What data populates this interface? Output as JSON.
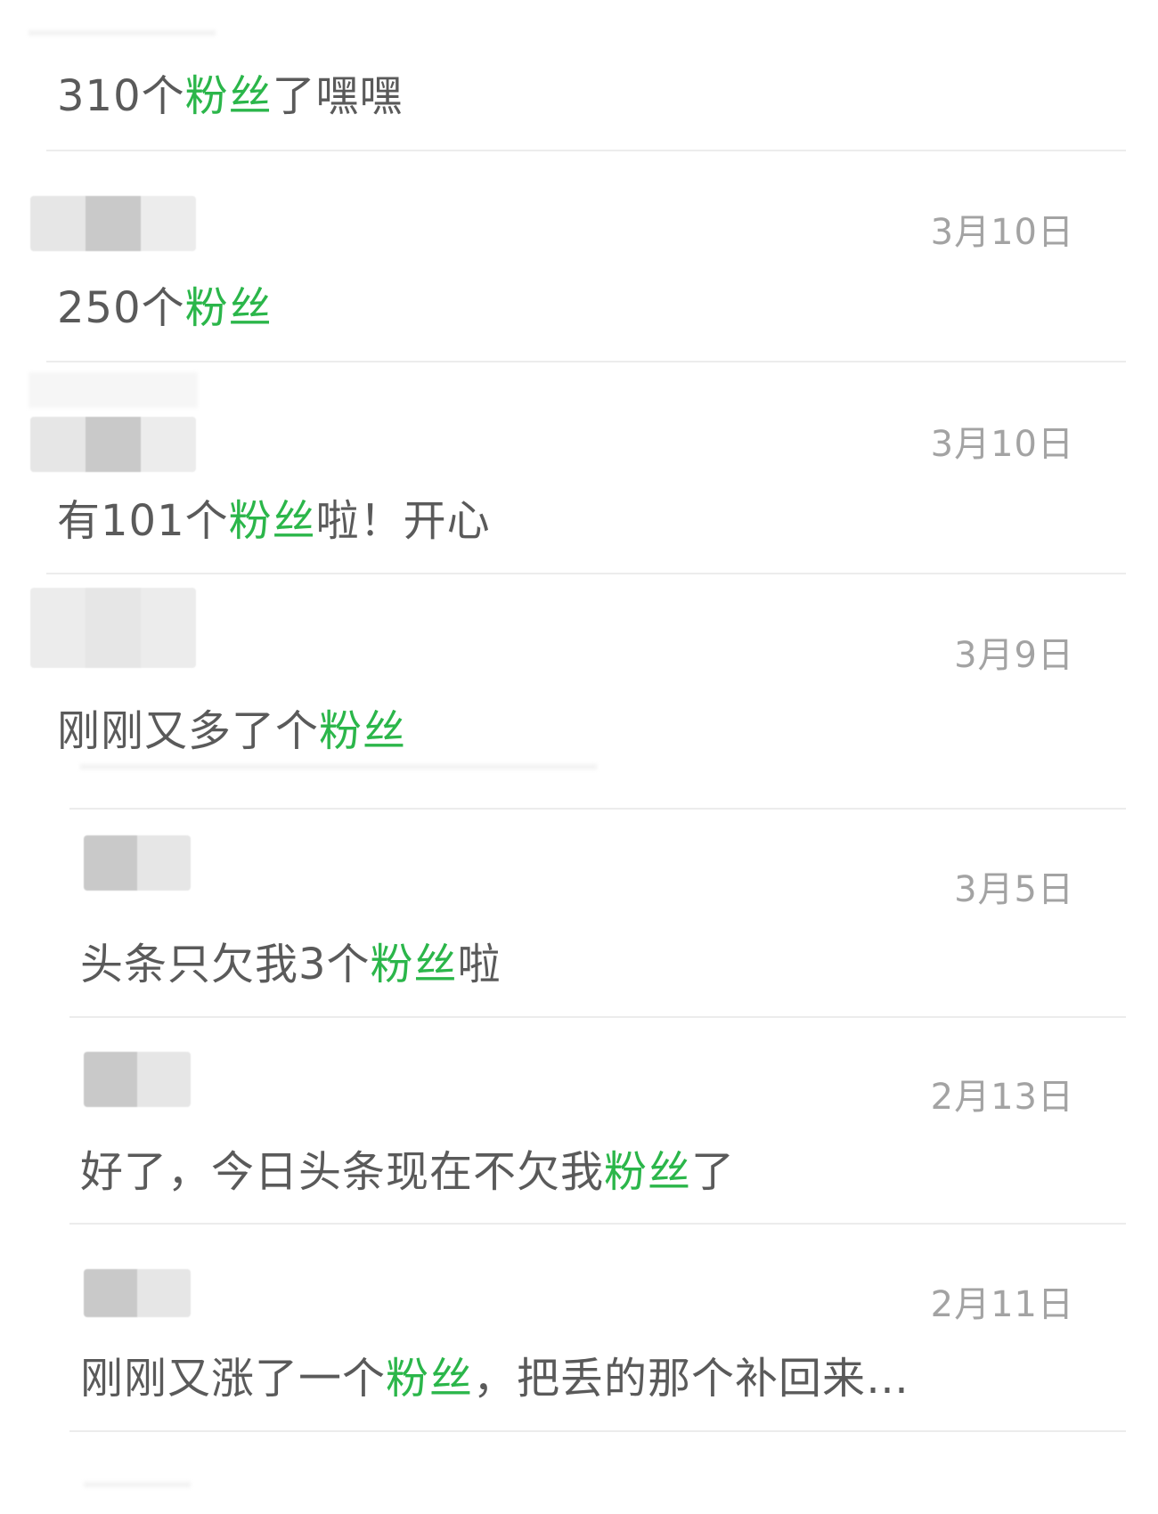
{
  "keyword_color": "#2bb64a",
  "feed": {
    "top_message": {
      "before": "310个",
      "keyword": "粉丝",
      "after": "了嘿嘿"
    },
    "entries": [
      {
        "date": "3月10日",
        "before": "250个",
        "keyword": "粉丝",
        "after": ""
      },
      {
        "date": "3月10日",
        "before": "有101个",
        "keyword": "粉丝",
        "after": "啦！开心"
      },
      {
        "date": "3月9日",
        "before": "刚刚又多了个",
        "keyword": "粉丝",
        "after": ""
      },
      {
        "date": "3月5日",
        "before": "头条只欠我3个",
        "keyword": "粉丝",
        "after": "啦"
      },
      {
        "date": "2月13日",
        "before": "好了，今日头条现在不欠我",
        "keyword": "粉丝",
        "after": "了"
      },
      {
        "date": "2月11日",
        "before": "刚刚又涨了一个",
        "keyword": "粉丝",
        "after": "，把丢的那个补回来…"
      }
    ]
  }
}
